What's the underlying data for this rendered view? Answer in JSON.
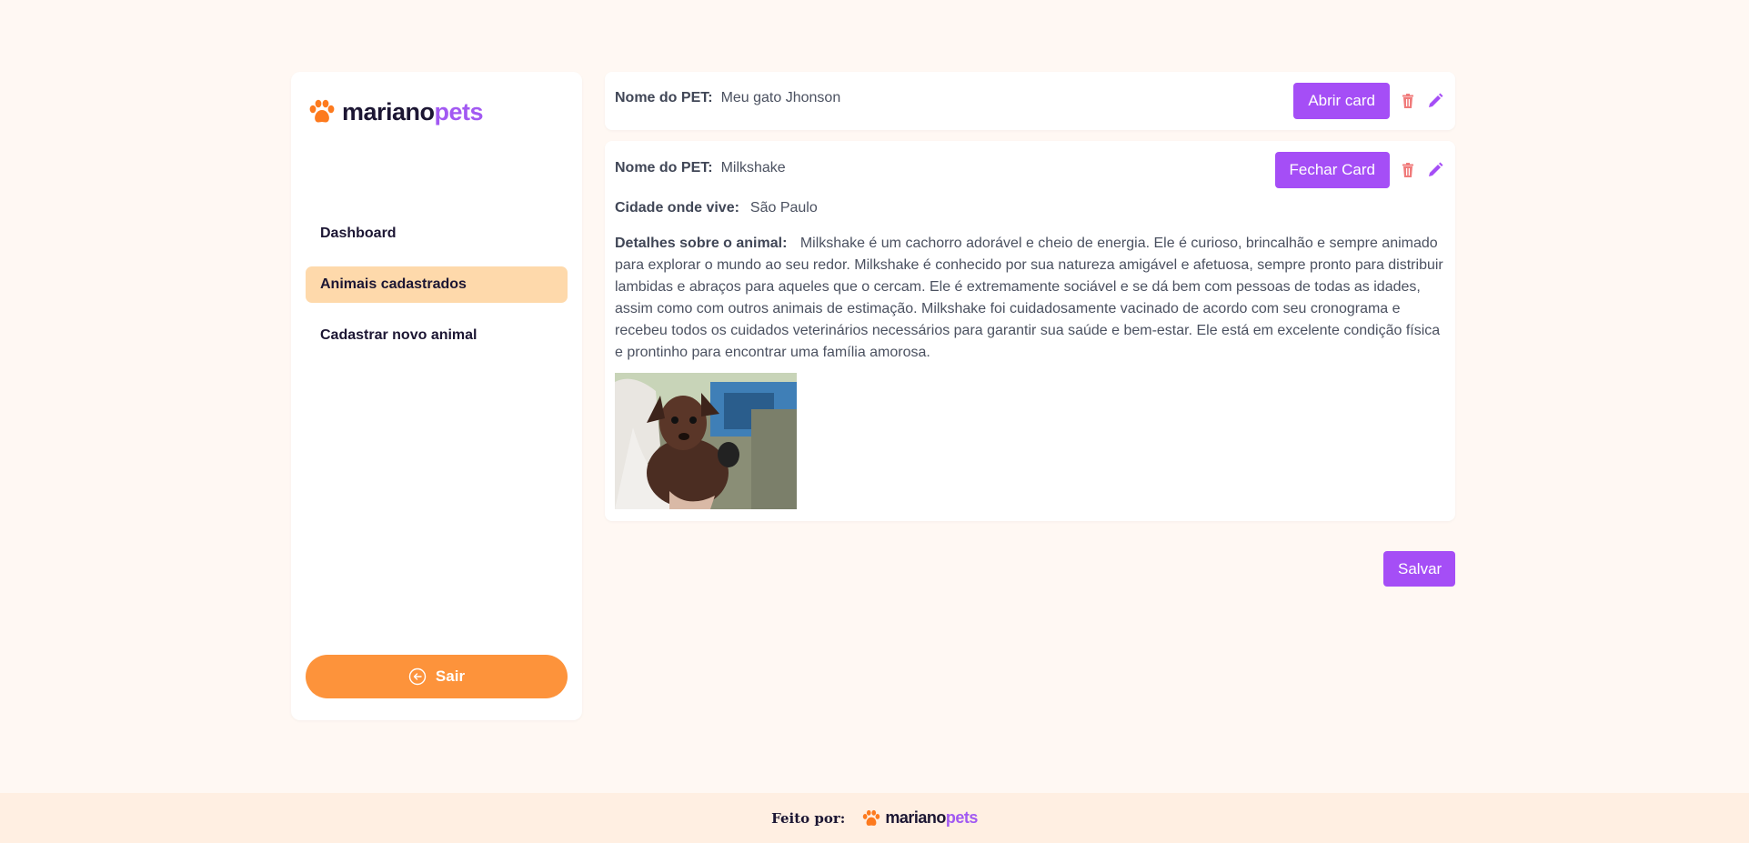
{
  "brand": {
    "name_part1": "mariano",
    "name_part2": "pets",
    "accent": "#a259f2",
    "primary": "#fd933b"
  },
  "sidebar": {
    "items": [
      {
        "label": "Dashboard"
      },
      {
        "label": "Animais cadastrados",
        "active": true
      },
      {
        "label": "Cadastrar novo animal"
      }
    ],
    "logout_label": "Sair"
  },
  "cards": [
    {
      "name_label": "Nome do PET:",
      "name_value": "Meu gato Jhonson",
      "toggle_label": "Abrir card"
    },
    {
      "name_label": "Nome do PET:",
      "name_value": "Milkshake",
      "toggle_label": "Fechar Card",
      "city_label": "Cidade onde vive:",
      "city_value": "São Paulo",
      "details_label": "Detalhes sobre o animal:",
      "details_value": "Milkshake é um cachorro adorável e cheio de energia. Ele é curioso, brincalhão e sempre animado para explorar o mundo ao seu redor. Milkshake é conhecido por sua natureza amigável e afetuosa, sempre pronto para distribuir lambidas e abraços para aqueles que o cercam. Ele é extremamente sociável e se dá bem com pessoas de todas as idades, assim como com outros animais de estimação. Milkshake foi cuidadosamente vacinado de acordo com seu cronograma e recebeu todos os cuidados veterinários necessários para garantir sua saúde e bem-estar. Ele está em excelente condição física e prontinho para encontrar uma família amorosa."
    }
  ],
  "save_label": "Salvar",
  "footer": {
    "label": "Feito por:"
  },
  "icons": {
    "trash": "trash-icon",
    "edit": "pencil-icon",
    "paw": "paw-icon",
    "logout": "logout-icon"
  },
  "colors": {
    "trash": "#f07b7b",
    "edit": "#a54ef6",
    "active_nav": "#fed9ab"
  }
}
